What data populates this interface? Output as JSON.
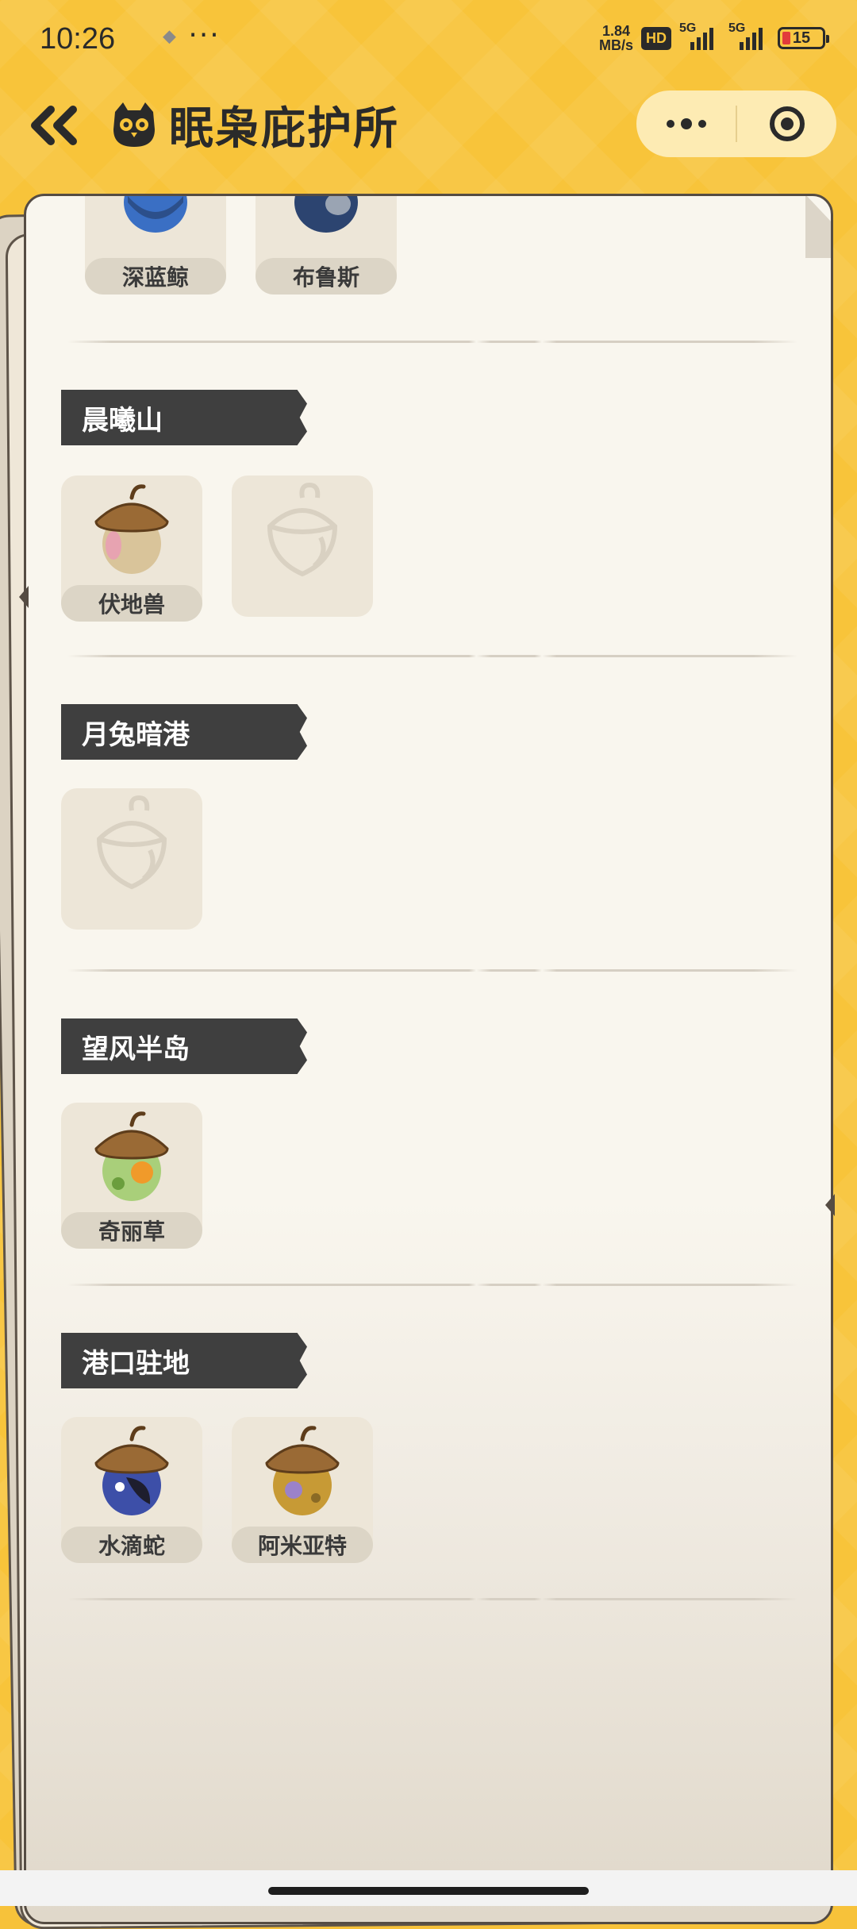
{
  "status_bar": {
    "time": "10:26",
    "extra": "···",
    "net_speed_value": "1.84",
    "net_speed_unit": "MB/s",
    "hd_label": "HD",
    "signal1_label": "5G",
    "signal2_label": "5G",
    "battery_level": "15"
  },
  "header": {
    "title": "眠枭庇护所",
    "back_icon": "double-chevron-left-icon",
    "more_icon": "more-dots-icon",
    "target_icon": "target-icon"
  },
  "top_partial": {
    "cards": [
      {
        "label": "深蓝鲸",
        "state": "collected",
        "colors": [
          "#3a6fc4",
          "#2c4f8a"
        ]
      },
      {
        "label": "布鲁斯",
        "state": "collected",
        "colors": [
          "#2c4470",
          "#9aa4b3"
        ]
      }
    ]
  },
  "regions": [
    {
      "name": "晨曦山",
      "cards": [
        {
          "label": "伏地兽",
          "state": "collected",
          "body": "#d9c49a",
          "accent": "#e7a3b1"
        },
        {
          "label": "",
          "state": "locked"
        }
      ]
    },
    {
      "name": "月兔暗港",
      "cards": [
        {
          "label": "",
          "state": "locked"
        }
      ]
    },
    {
      "name": "望风半岛",
      "cards": [
        {
          "label": "奇丽草",
          "state": "collected",
          "body": "#a9cf7a",
          "accent": "#f09a2a"
        }
      ]
    },
    {
      "name": "港口驻地",
      "cards": [
        {
          "label": "水滴蛇",
          "state": "collected",
          "body": "#3d4fa8",
          "accent": "#1e1e2e"
        },
        {
          "label": "阿米亚特",
          "state": "collected",
          "body": "#c79a35",
          "accent": "#9b82c9"
        }
      ]
    }
  ],
  "colors": {
    "background": "#f8c43a",
    "paper": "#f9f6ee",
    "tag": "#3f3f3f",
    "card": "#ede6d8"
  }
}
